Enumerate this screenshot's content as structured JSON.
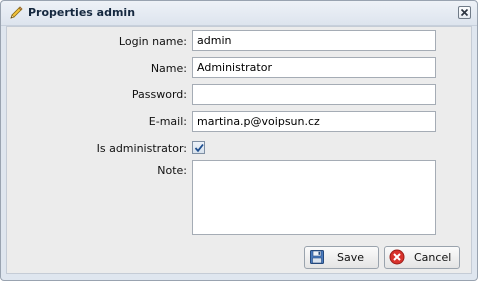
{
  "window": {
    "title": "Properties admin",
    "title_icon": "pencil-icon",
    "close_icon": "close-icon"
  },
  "form": {
    "login_name": {
      "label": "Login name:",
      "value": "admin"
    },
    "name": {
      "label": "Name:",
      "value": "Administrator"
    },
    "password": {
      "label": "Password:",
      "value": ""
    },
    "email": {
      "label": "E-mail:",
      "value": "martina.p@voipsun.cz"
    },
    "is_admin": {
      "label": "Is administrator:",
      "checked": true
    },
    "note": {
      "label": "Note:",
      "value": ""
    }
  },
  "buttons": {
    "save": {
      "label": "Save",
      "icon": "floppy-disk-icon"
    },
    "cancel": {
      "label": "Cancel",
      "icon": "cancel-icon"
    }
  },
  "colors": {
    "accent": "#3a6ea5",
    "cancel_red": "#d8322c"
  }
}
